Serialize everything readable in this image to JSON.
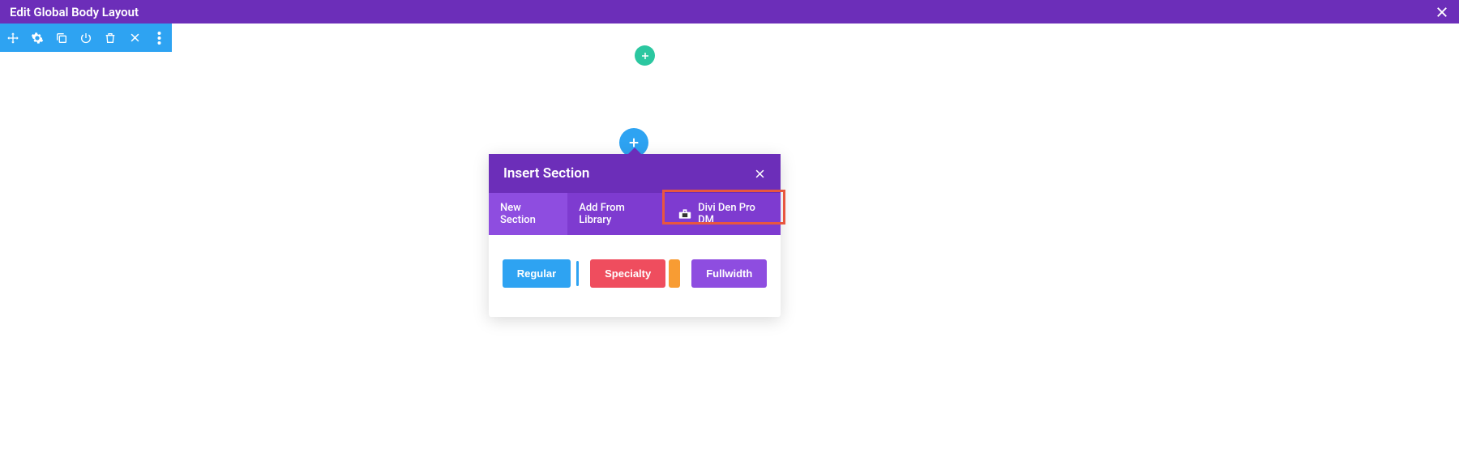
{
  "topbar": {
    "title": "Edit Global Body Layout"
  },
  "modal": {
    "title": "Insert Section",
    "tabs": {
      "new_section": "New Section",
      "add_from_library": "Add From Library",
      "divi_den": "Divi Den Pro DM"
    },
    "buttons": {
      "regular": "Regular",
      "specialty": "Specialty",
      "fullwidth": "Fullwidth"
    }
  }
}
